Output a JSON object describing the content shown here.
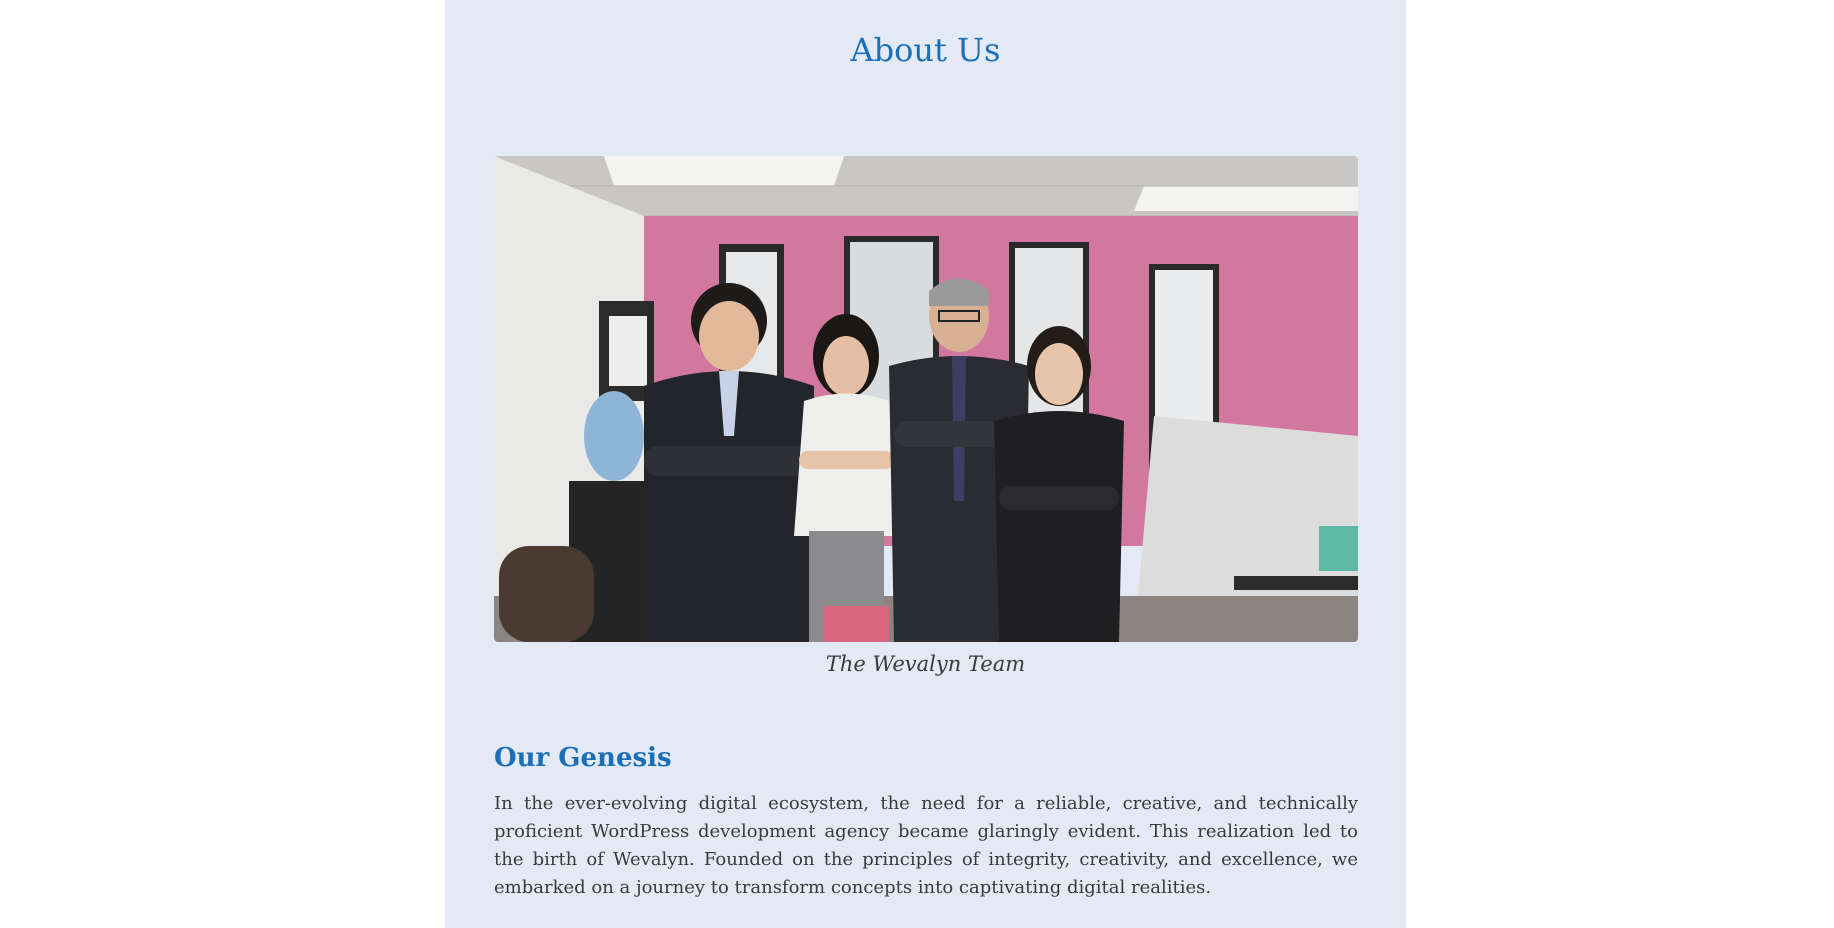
{
  "page": {
    "title": "About Us"
  },
  "hero": {
    "image_icon": "team-photo",
    "caption": "The Wevalyn Team"
  },
  "genesis": {
    "heading": "Our Genesis",
    "body": "In the ever-evolving digital ecosystem, the need for a reliable, creative, and technically proficient WordPress development agency became glaringly evident. This realization led to the birth of Wevalyn. Founded on the principles of integrity, creativity, and excellence, we embarked on a journey to transform concepts into captivating digital realities."
  },
  "colors": {
    "accent": "#1a6fb6",
    "panel_background": "#e3eaf6",
    "body_text": "#3a3a3a"
  }
}
